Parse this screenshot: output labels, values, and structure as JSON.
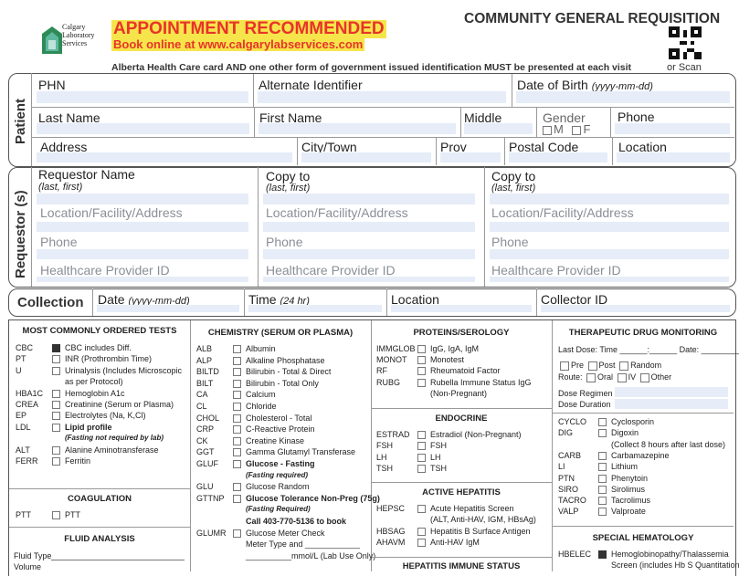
{
  "header": {
    "logo_text": [
      "Calgary",
      "Laboratory",
      "Services"
    ],
    "appt_title": "APPOINTMENT RECOMMENDED",
    "appt_sub": "Book online at www.calgarylabservices.com",
    "form_title": "COMMUNITY GENERAL REQUISITION",
    "id_notice": "Alberta Health Care card AND one other form of government issued identification MUST be presented at each visit",
    "or_scan": "or Scan"
  },
  "patient": {
    "section_label": "Patient",
    "phn": "PHN",
    "alt_id": "Alternate Identifier",
    "dob": "Date of Birth",
    "dob_fmt": "(yyyy-mm-dd)",
    "last_name": "Last Name",
    "first_name": "First Name",
    "middle": "Middle",
    "gender": "Gender",
    "gender_m": "M",
    "gender_f": "F",
    "phone": "Phone",
    "address": "Address",
    "city": "City/Town",
    "prov": "Prov",
    "postal": "Postal Code",
    "location": "Location"
  },
  "requestor": {
    "section_label": "Requestor (s)",
    "cols": [
      {
        "title": "Requestor Name",
        "sub": "(last, first)",
        "loc": "Location/Facility/Address",
        "phone": "Phone",
        "hpid": "Healthcare Provider ID"
      },
      {
        "title": "Copy to",
        "sub": "(last, first)",
        "loc": "Location/Facility/Address",
        "phone": "Phone",
        "hpid": "Healthcare Provider ID"
      },
      {
        "title": "Copy to",
        "sub": "(last, first)",
        "loc": "Location/Facility/Address",
        "phone": "Phone",
        "hpid": "Healthcare Provider ID"
      }
    ]
  },
  "collection": {
    "section_label": "Collection",
    "date": "Date",
    "date_fmt": "(yyyy-mm-dd)",
    "time": "Time",
    "time_fmt": "(24 hr)",
    "location": "Location",
    "collector": "Collector ID"
  },
  "col1": {
    "heading": "MOST COMMONLY ORDERED TESTS",
    "items": [
      {
        "code": "CBC",
        "text": "CBC includes Diff.",
        "checked": true
      },
      {
        "code": "PT",
        "text": "INR (Prothrombin Time)"
      },
      {
        "code": "U",
        "text": "Urinalysis (Includes Microscopic"
      },
      {
        "code": "",
        "text": "as per Protocol)",
        "nobox": true
      },
      {
        "code": "HBA1C",
        "text": "Hemoglobin A1c"
      },
      {
        "code": "CREA",
        "text": "Creatinine (Serum or Plasma)"
      },
      {
        "code": "EP",
        "text": "Electrolytes (Na, K,Cl)"
      },
      {
        "code": "LDL",
        "text": "Lipid profile",
        "bold": true
      },
      {
        "code": "",
        "text": "(Fasting not required by lab)",
        "nobox": true,
        "note": true
      },
      {
        "code": "ALT",
        "text": "Alanine Aminotransferase"
      },
      {
        "code": "FERR",
        "text": "Ferritin"
      }
    ],
    "coag_heading": "COAGULATION",
    "coag_code": "PTT",
    "coag_text": "PTT",
    "fluid_heading": "FLUID ANALYSIS",
    "fluid_type": "Fluid Type",
    "volume": "Volume"
  },
  "col2": {
    "heading": "CHEMISTRY (SERUM OR PLASMA)",
    "items": [
      {
        "code": "ALB",
        "text": "Albumin"
      },
      {
        "code": "ALP",
        "text": "Alkaline Phosphatase"
      },
      {
        "code": "BILTD",
        "text": "Bilirubin - Total & Direct"
      },
      {
        "code": "BILT",
        "text": "Bilirubin - Total Only"
      },
      {
        "code": "CA",
        "text": "Calcium"
      },
      {
        "code": "CL",
        "text": "Chloride"
      },
      {
        "code": "CHOL",
        "text": "Cholesterol - Total"
      },
      {
        "code": "CRP",
        "text": "C-Reactive Protein"
      },
      {
        "code": "CK",
        "text": "Creatine Kinase"
      },
      {
        "code": "GGT",
        "text": "Gamma Glutamyl Transferase"
      },
      {
        "code": "GLUF",
        "text": "Glucose - Fasting",
        "bold": true
      },
      {
        "code": "",
        "text": "(Fasting required)",
        "nobox": true,
        "note": true
      },
      {
        "code": "GLU",
        "text": "Glucose Random"
      },
      {
        "code": "GTTNP",
        "text": "Glucose Tolerance Non-Preg (75g)",
        "bold": true
      },
      {
        "code": "",
        "text": "(Fasting Required)",
        "nobox": true,
        "note": true
      },
      {
        "code": "",
        "text": "Call 403-770-5136 to book",
        "nobox": true,
        "bold": true
      },
      {
        "code": "GLUMR",
        "text": "Glucose Meter Check"
      },
      {
        "code": "",
        "text": "Meter Type and ____________",
        "nobox": true
      },
      {
        "code": "",
        "text": "__________mmol/L (Lab Use Only)",
        "nobox": true
      }
    ]
  },
  "col3": {
    "heading": "PROTEINS/SEROLOGY",
    "items": [
      {
        "code": "IMMGLOB",
        "text": "IgG, IgA, IgM"
      },
      {
        "code": "MONOT",
        "text": "Monotest"
      },
      {
        "code": "RF",
        "text": "Rheumatoid Factor"
      },
      {
        "code": "RUBG",
        "text": "Rubella Immune Status IgG"
      },
      {
        "code": "",
        "text": "(Non-Pregnant)",
        "nobox": true
      }
    ],
    "endo_heading": "ENDOCRINE",
    "endo_items": [
      {
        "code": "ESTRAD",
        "text": "Estradiol (Non-Pregnant)"
      },
      {
        "code": "FSH",
        "text": "FSH"
      },
      {
        "code": "LH",
        "text": "LH"
      },
      {
        "code": "TSH",
        "text": "TSH"
      }
    ],
    "hep_heading": "ACTIVE HEPATITIS",
    "hep_items": [
      {
        "code": "HEPSC",
        "text": "Acute Hepatitis Screen"
      },
      {
        "code": "",
        "text": "(ALT, Anti-HAV, IGM, HBsAg)",
        "nobox": true
      },
      {
        "code": "HBSAG",
        "text": "Hepatitis B Surface Antigen"
      },
      {
        "code": "AHAVM",
        "text": "Anti-HAV IgM"
      }
    ],
    "hepimm_heading": "HEPATITIS IMMUNE STATUS"
  },
  "col4": {
    "heading": "THERAPEUTIC DRUG MONITORING",
    "last_dose": "Last Dose: Time ______:______ Date: ____________",
    "pre": "Pre",
    "post": "Post",
    "random": "Random",
    "route": "Route:",
    "oral": "Oral",
    "iv": "IV",
    "other": "Other",
    "dose_regimen": "Dose Regimen",
    "dose_duration": "Dose Duration",
    "items": [
      {
        "code": "CYCLO",
        "text": "Cyclosporin"
      },
      {
        "code": "DIG",
        "text": "Digoxin"
      },
      {
        "code": "",
        "text": "(Collect 8 hours after last dose)",
        "nobox": true
      },
      {
        "code": "CARB",
        "text": "Carbamazepine"
      },
      {
        "code": "LI",
        "text": "Lithium"
      },
      {
        "code": "PTN",
        "text": "Phenytoin"
      },
      {
        "code": "SIRO",
        "text": "Sirolimus"
      },
      {
        "code": "TACRO",
        "text": "Tacrolimus"
      },
      {
        "code": "VALP",
        "text": "Valproate"
      }
    ],
    "heme_heading": "SPECIAL HEMATOLOGY",
    "heme_code": "HBELEC",
    "heme_text1": "Hemoglobinopathy/Thalassemia",
    "heme_text2": "Screen (includes Hb S Quantitation)"
  },
  "colors": {
    "accent_red": "#e8332a",
    "appt_fill": "#f6e54a",
    "field": "#e6edf8",
    "logo_green": "#2e8b57"
  }
}
